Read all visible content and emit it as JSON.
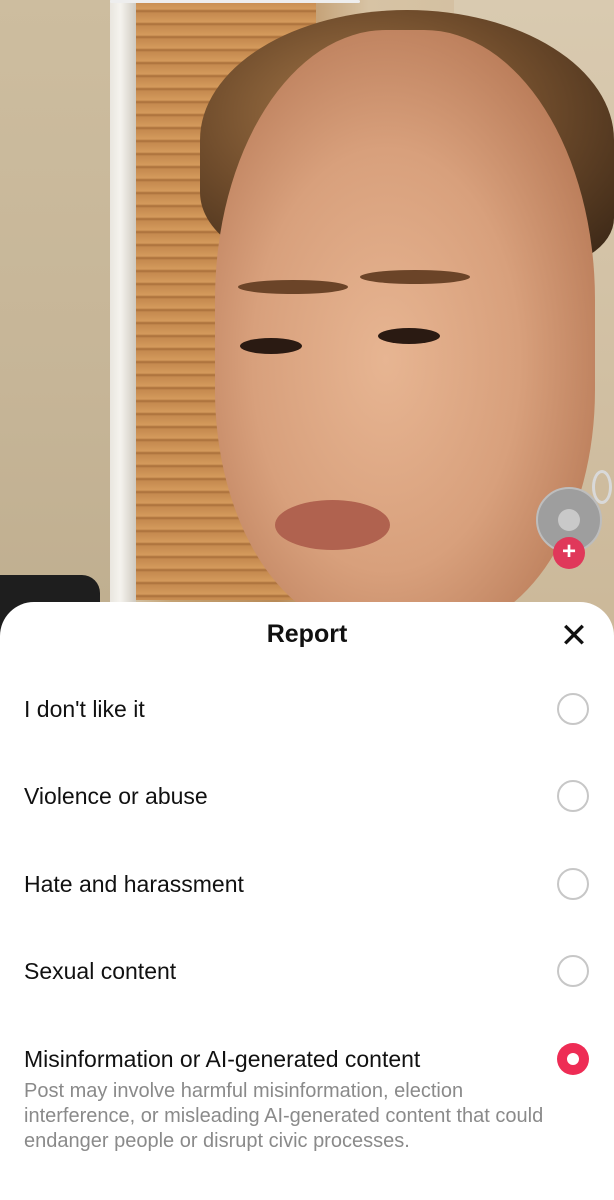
{
  "report_sheet": {
    "title": "Report",
    "close_icon": "close-icon",
    "options": [
      {
        "label": "I don't like it",
        "selected": false
      },
      {
        "label": "Violence or abuse",
        "selected": false
      },
      {
        "label": "Hate and harassment",
        "selected": false
      },
      {
        "label": "Sexual content",
        "selected": false
      },
      {
        "label": "Misinformation or AI-generated content",
        "selected": true
      }
    ],
    "selected_description": "Post may involve harmful misinformation, election interference, or misleading AI-generated content that could endanger people or disrupt civic processes."
  },
  "video": {
    "follow_button_label": "+"
  },
  "colors": {
    "accent": "#ee2c55",
    "text_primary": "#111111",
    "text_secondary": "#8a8a8a",
    "radio_border": "#c7c7c7"
  }
}
